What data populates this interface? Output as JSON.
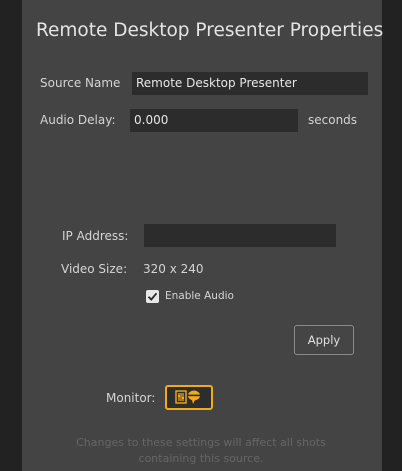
{
  "title": "Remote Desktop Presenter Properties",
  "source_name": {
    "label": "Source Name",
    "value": "Remote Desktop Presenter"
  },
  "audio_delay": {
    "label": "Audio Delay:",
    "value": "0.000",
    "unit": "seconds"
  },
  "ip_address": {
    "label": "IP Address:",
    "value": ""
  },
  "video_size": {
    "label": "Video Size:",
    "value": "320 x 240"
  },
  "enable_audio": {
    "label": "Enable Audio",
    "checked": true
  },
  "apply_label": "Apply",
  "monitor": {
    "label": "Monitor:",
    "icon": "monitor-audio-icon",
    "accent": "#f0ab1a"
  },
  "footer_note": "Changes to these settings will affect all shots containing this source."
}
